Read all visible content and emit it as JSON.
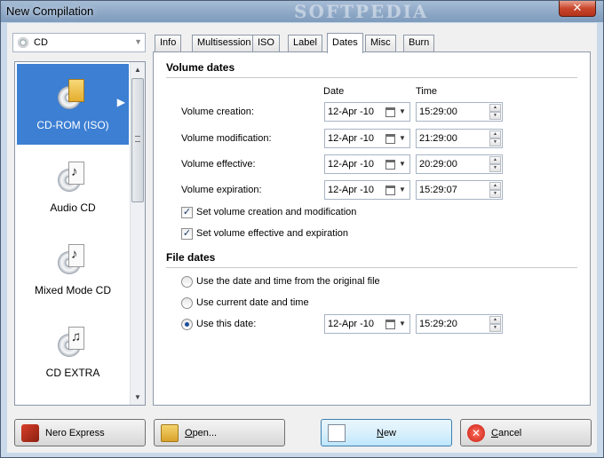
{
  "window": {
    "title": "New Compilation",
    "watermark": "SOFTPEDIA",
    "close_glyph": "✕"
  },
  "media_select": {
    "value": "CD",
    "icon": "cd-icon"
  },
  "media_list": {
    "items": [
      {
        "label": "CD-ROM (ISO)",
        "icon": "cd-rom-iso-icon",
        "selected": true
      },
      {
        "label": "Audio CD",
        "icon": "audio-cd-icon",
        "selected": false
      },
      {
        "label": "Mixed Mode CD",
        "icon": "mixed-mode-cd-icon",
        "selected": false
      },
      {
        "label": "CD EXTRA",
        "icon": "cd-extra-icon",
        "selected": false
      }
    ]
  },
  "tabs": [
    {
      "label": "Info"
    },
    {
      "label": "Multisession"
    },
    {
      "label": "ISO"
    },
    {
      "label": "Label"
    },
    {
      "label": "Dates",
      "active": true
    },
    {
      "label": "Misc"
    },
    {
      "label": "Burn"
    }
  ],
  "volume_dates": {
    "heading": "Volume dates",
    "date_col": "Date",
    "time_col": "Time",
    "rows": [
      {
        "label": "Volume creation:",
        "date": "12-Apr -10",
        "time": "15:29:00"
      },
      {
        "label": "Volume modification:",
        "date": "12-Apr -10",
        "time": "21:29:00"
      },
      {
        "label": "Volume effective:",
        "date": "12-Apr -10",
        "time": "20:29:00"
      },
      {
        "label": "Volume expiration:",
        "date": "12-Apr -10",
        "time": "15:29:07"
      }
    ],
    "checkboxes": [
      {
        "label": "Set volume creation and modification",
        "checked": true
      },
      {
        "label": "Set volume effective and expiration",
        "checked": true
      }
    ]
  },
  "file_dates": {
    "heading": "File dates",
    "options": [
      {
        "label": "Use the date and time from the original file",
        "selected": false
      },
      {
        "label": "Use current date and time",
        "selected": false
      },
      {
        "label": "Use this date:",
        "selected": true
      }
    ],
    "date": "12-Apr -10",
    "time": "15:29:20"
  },
  "buttons": {
    "nero_express": "Nero Express",
    "open_key": "O",
    "open_rest": "pen...",
    "new_key": "N",
    "new_rest": "ew",
    "cancel_key": "C",
    "cancel_rest": "ancel"
  }
}
